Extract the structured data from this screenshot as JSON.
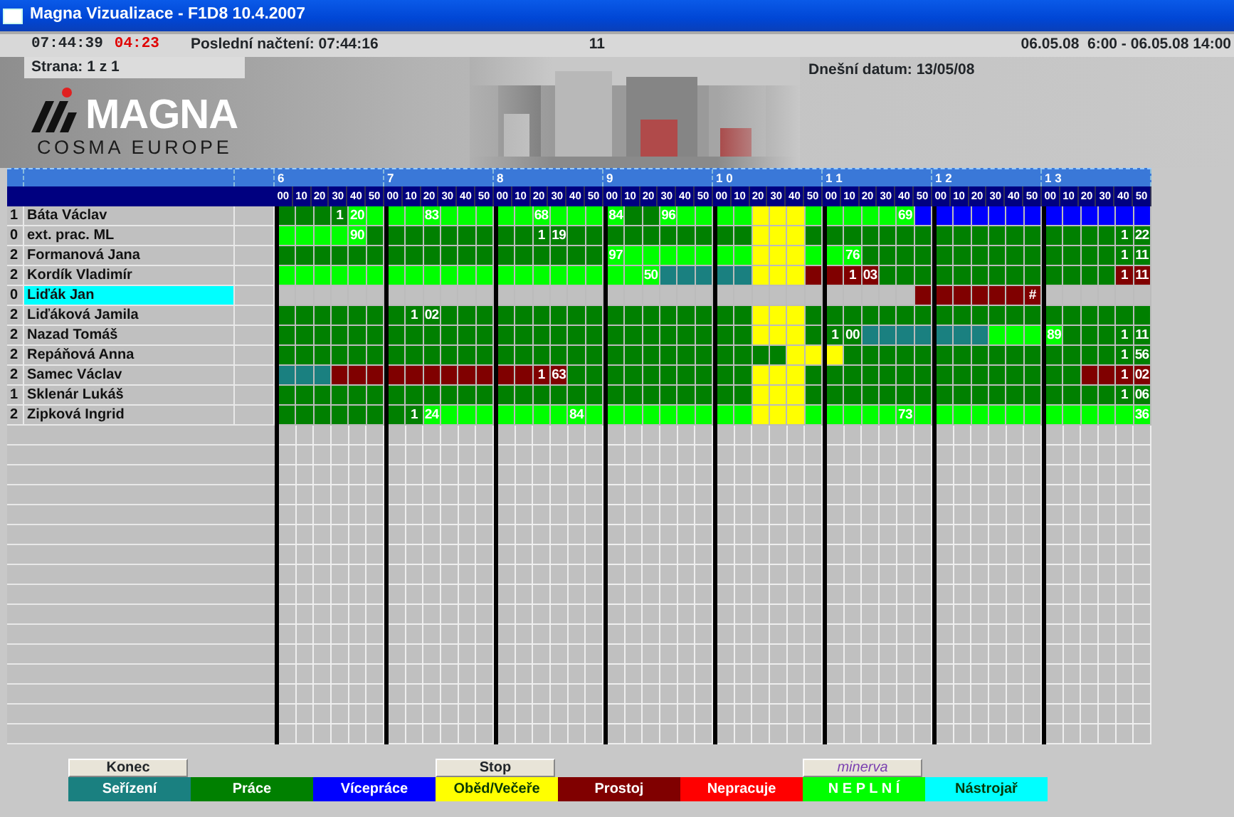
{
  "window": {
    "title": "Magna Vizualizace - F1D8 10.4.2007"
  },
  "info_bar": {
    "clock": "07:44:39",
    "timer": "04:23",
    "last_load": "Poslední načtení: 07:44:16",
    "count": "11",
    "shift": "06.05.08  6:00 - 06.05.08 14:00"
  },
  "page_info": "Strana: 1 z 1",
  "today": "Dnešní datum: 13/05/08",
  "logo": {
    "name": "MAGNA",
    "subtitle": "COSMA EUROPE"
  },
  "hours": [
    {
      "label": "6",
      "minutes": [
        "00",
        "10",
        "20",
        "30",
        "40",
        "50"
      ]
    },
    {
      "label": "7",
      "minutes": [
        "00",
        "10",
        "20",
        "30",
        "40",
        "50"
      ]
    },
    {
      "label": "8",
      "minutes": [
        "00",
        "10",
        "20",
        "30",
        "40",
        "50"
      ]
    },
    {
      "label": "9",
      "minutes": [
        "00",
        "10",
        "20",
        "30",
        "40",
        "50"
      ]
    },
    {
      "label": "1 0",
      "minutes": [
        "00",
        "10",
        "20",
        "30",
        "40",
        "50"
      ]
    },
    {
      "label": "1 1",
      "minutes": [
        "00",
        "10",
        "20",
        "30",
        "40",
        "50"
      ]
    },
    {
      "label": "1 2",
      "minutes": [
        "00",
        "10",
        "20",
        "30",
        "40",
        "50"
      ]
    },
    {
      "label": "1 3",
      "minutes": [
        "00",
        "10",
        "20",
        "30",
        "40",
        "50"
      ]
    }
  ],
  "rows": [
    {
      "number": "1",
      "name": "Báta Václav",
      "highlighted": false,
      "cells": [
        {
          "kind": "work"
        },
        {
          "kind": "work"
        },
        {
          "kind": "work"
        },
        {
          "kind": "work",
          "text": "1"
        },
        {
          "kind": "short",
          "text": "20"
        },
        {
          "kind": "short"
        },
        {
          "kind": "short"
        },
        {
          "kind": "short"
        },
        {
          "kind": "short",
          "text": "83"
        },
        {
          "kind": "short"
        },
        {
          "kind": "short"
        },
        {
          "kind": "short"
        },
        {
          "kind": "short"
        },
        {
          "kind": "short"
        },
        {
          "kind": "short",
          "text": "68"
        },
        {
          "kind": "short"
        },
        {
          "kind": "short"
        },
        {
          "kind": "short"
        },
        {
          "kind": "short",
          "text": "84"
        },
        {
          "kind": "work"
        },
        {
          "kind": "work"
        },
        {
          "kind": "short",
          "text": "96"
        },
        {
          "kind": "short"
        },
        {
          "kind": "short"
        },
        {
          "kind": "short"
        },
        {
          "kind": "short"
        },
        {
          "kind": "lunch"
        },
        {
          "kind": "lunch"
        },
        {
          "kind": "lunch"
        },
        {
          "kind": "short"
        },
        {
          "kind": "short"
        },
        {
          "kind": "short"
        },
        {
          "kind": "short"
        },
        {
          "kind": "short"
        },
        {
          "kind": "short",
          "text": "69"
        },
        {
          "kind": "extra"
        },
        {
          "kind": "extra"
        },
        {
          "kind": "extra"
        },
        {
          "kind": "extra"
        },
        {
          "kind": "extra"
        },
        {
          "kind": "extra"
        },
        {
          "kind": "extra"
        },
        {
          "kind": "extra"
        },
        {
          "kind": "extra"
        },
        {
          "kind": "extra"
        },
        {
          "kind": "extra"
        },
        {
          "kind": "extra"
        },
        {
          "kind": "extra"
        }
      ]
    },
    {
      "number": "0",
      "name": "ext. prac. ML",
      "highlighted": false,
      "cells": [
        {
          "kind": "short"
        },
        {
          "kind": "short"
        },
        {
          "kind": "short"
        },
        {
          "kind": "short"
        },
        {
          "kind": "short",
          "text": "90"
        },
        {
          "kind": "work"
        },
        {
          "kind": "work"
        },
        {
          "kind": "work"
        },
        {
          "kind": "work"
        },
        {
          "kind": "work"
        },
        {
          "kind": "work"
        },
        {
          "kind": "work"
        },
        {
          "kind": "work"
        },
        {
          "kind": "work"
        },
        {
          "kind": "work",
          "text": "1"
        },
        {
          "kind": "work",
          "text": "19"
        },
        {
          "kind": "work"
        },
        {
          "kind": "work"
        },
        {
          "kind": "work"
        },
        {
          "kind": "work"
        },
        {
          "kind": "work"
        },
        {
          "kind": "work"
        },
        {
          "kind": "work"
        },
        {
          "kind": "work"
        },
        {
          "kind": "work"
        },
        {
          "kind": "work"
        },
        {
          "kind": "lunch"
        },
        {
          "kind": "lunch"
        },
        {
          "kind": "lunch"
        },
        {
          "kind": "work"
        },
        {
          "kind": "work"
        },
        {
          "kind": "work"
        },
        {
          "kind": "work"
        },
        {
          "kind": "work"
        },
        {
          "kind": "work"
        },
        {
          "kind": "work"
        },
        {
          "kind": "work"
        },
        {
          "kind": "work"
        },
        {
          "kind": "work"
        },
        {
          "kind": "work"
        },
        {
          "kind": "work"
        },
        {
          "kind": "work"
        },
        {
          "kind": "work"
        },
        {
          "kind": "work"
        },
        {
          "kind": "work"
        },
        {
          "kind": "work"
        },
        {
          "kind": "work",
          "text": "1"
        },
        {
          "kind": "work",
          "text": "22"
        }
      ]
    },
    {
      "number": "2",
      "name": "Formanová Jana",
      "highlighted": false,
      "cells": [
        {
          "kind": "work"
        },
        {
          "kind": "work"
        },
        {
          "kind": "work"
        },
        {
          "kind": "work"
        },
        {
          "kind": "work"
        },
        {
          "kind": "work"
        },
        {
          "kind": "work"
        },
        {
          "kind": "work"
        },
        {
          "kind": "work"
        },
        {
          "kind": "work"
        },
        {
          "kind": "work"
        },
        {
          "kind": "work"
        },
        {
          "kind": "work"
        },
        {
          "kind": "work"
        },
        {
          "kind": "work"
        },
        {
          "kind": "work"
        },
        {
          "kind": "work"
        },
        {
          "kind": "work"
        },
        {
          "kind": "short",
          "text": "97"
        },
        {
          "kind": "short"
        },
        {
          "kind": "short"
        },
        {
          "kind": "short"
        },
        {
          "kind": "short"
        },
        {
          "kind": "short"
        },
        {
          "kind": "short"
        },
        {
          "kind": "short"
        },
        {
          "kind": "lunch"
        },
        {
          "kind": "lunch"
        },
        {
          "kind": "lunch"
        },
        {
          "kind": "short"
        },
        {
          "kind": "short"
        },
        {
          "kind": "short",
          "text": "76"
        },
        {
          "kind": "work"
        },
        {
          "kind": "work"
        },
        {
          "kind": "work"
        },
        {
          "kind": "work"
        },
        {
          "kind": "work"
        },
        {
          "kind": "work"
        },
        {
          "kind": "work"
        },
        {
          "kind": "work"
        },
        {
          "kind": "work"
        },
        {
          "kind": "work"
        },
        {
          "kind": "work"
        },
        {
          "kind": "work"
        },
        {
          "kind": "work"
        },
        {
          "kind": "work"
        },
        {
          "kind": "work",
          "text": "1"
        },
        {
          "kind": "work",
          "text": "11"
        }
      ]
    },
    {
      "number": "2",
      "name": "Kordík Vladimír",
      "highlighted": false,
      "cells": [
        {
          "kind": "short"
        },
        {
          "kind": "short"
        },
        {
          "kind": "short"
        },
        {
          "kind": "short"
        },
        {
          "kind": "short"
        },
        {
          "kind": "short"
        },
        {
          "kind": "short"
        },
        {
          "kind": "short"
        },
        {
          "kind": "short"
        },
        {
          "kind": "short"
        },
        {
          "kind": "short"
        },
        {
          "kind": "short"
        },
        {
          "kind": "short"
        },
        {
          "kind": "short"
        },
        {
          "kind": "short"
        },
        {
          "kind": "short"
        },
        {
          "kind": "short"
        },
        {
          "kind": "short"
        },
        {
          "kind": "short"
        },
        {
          "kind": "short"
        },
        {
          "kind": "short",
          "text": "50"
        },
        {
          "kind": "setup"
        },
        {
          "kind": "setup"
        },
        {
          "kind": "setup"
        },
        {
          "kind": "setup"
        },
        {
          "kind": "setup"
        },
        {
          "kind": "lunch"
        },
        {
          "kind": "lunch"
        },
        {
          "kind": "lunch"
        },
        {
          "kind": "downtime"
        },
        {
          "kind": "downtime"
        },
        {
          "kind": "downtime",
          "text": "1"
        },
        {
          "kind": "downtime",
          "text": "03"
        },
        {
          "kind": "work"
        },
        {
          "kind": "work"
        },
        {
          "kind": "work"
        },
        {
          "kind": "work"
        },
        {
          "kind": "work"
        },
        {
          "kind": "work"
        },
        {
          "kind": "work"
        },
        {
          "kind": "work"
        },
        {
          "kind": "work"
        },
        {
          "kind": "work"
        },
        {
          "kind": "work"
        },
        {
          "kind": "work"
        },
        {
          "kind": "work"
        },
        {
          "kind": "downtime",
          "text": "1"
        },
        {
          "kind": "downtime",
          "text": "11"
        }
      ]
    },
    {
      "number": "0",
      "name": "Liďák Jan",
      "highlighted": true,
      "cells": [
        {
          "kind": "none"
        },
        {
          "kind": "none"
        },
        {
          "kind": "none"
        },
        {
          "kind": "none"
        },
        {
          "kind": "none"
        },
        {
          "kind": "none"
        },
        {
          "kind": "none"
        },
        {
          "kind": "none"
        },
        {
          "kind": "none"
        },
        {
          "kind": "none"
        },
        {
          "kind": "none"
        },
        {
          "kind": "none"
        },
        {
          "kind": "none"
        },
        {
          "kind": "none"
        },
        {
          "kind": "none"
        },
        {
          "kind": "none"
        },
        {
          "kind": "none"
        },
        {
          "kind": "none"
        },
        {
          "kind": "none"
        },
        {
          "kind": "none"
        },
        {
          "kind": "none"
        },
        {
          "kind": "none"
        },
        {
          "kind": "none"
        },
        {
          "kind": "none"
        },
        {
          "kind": "none"
        },
        {
          "kind": "none"
        },
        {
          "kind": "none"
        },
        {
          "kind": "none"
        },
        {
          "kind": "none"
        },
        {
          "kind": "none"
        },
        {
          "kind": "none"
        },
        {
          "kind": "none"
        },
        {
          "kind": "none"
        },
        {
          "kind": "none"
        },
        {
          "kind": "none"
        },
        {
          "kind": "downtime"
        },
        {
          "kind": "downtime"
        },
        {
          "kind": "downtime"
        },
        {
          "kind": "downtime"
        },
        {
          "kind": "downtime"
        },
        {
          "kind": "downtime"
        },
        {
          "kind": "downtime",
          "text": "#"
        },
        {
          "kind": "none"
        },
        {
          "kind": "none"
        },
        {
          "kind": "none"
        },
        {
          "kind": "none"
        },
        {
          "kind": "none"
        },
        {
          "kind": "none"
        }
      ]
    },
    {
      "number": "2",
      "name": "Liďáková Jamila",
      "highlighted": false,
      "cells": [
        {
          "kind": "work"
        },
        {
          "kind": "work"
        },
        {
          "kind": "work"
        },
        {
          "kind": "work"
        },
        {
          "kind": "work"
        },
        {
          "kind": "work"
        },
        {
          "kind": "work"
        },
        {
          "kind": "work",
          "text": "1"
        },
        {
          "kind": "work",
          "text": "02"
        },
        {
          "kind": "work"
        },
        {
          "kind": "work"
        },
        {
          "kind": "work"
        },
        {
          "kind": "work"
        },
        {
          "kind": "work"
        },
        {
          "kind": "work"
        },
        {
          "kind": "work"
        },
        {
          "kind": "work"
        },
        {
          "kind": "work"
        },
        {
          "kind": "work"
        },
        {
          "kind": "work"
        },
        {
          "kind": "work"
        },
        {
          "kind": "work"
        },
        {
          "kind": "work"
        },
        {
          "kind": "work"
        },
        {
          "kind": "work"
        },
        {
          "kind": "work"
        },
        {
          "kind": "lunch"
        },
        {
          "kind": "lunch"
        },
        {
          "kind": "lunch"
        },
        {
          "kind": "work"
        },
        {
          "kind": "work"
        },
        {
          "kind": "work"
        },
        {
          "kind": "work"
        },
        {
          "kind": "work"
        },
        {
          "kind": "work"
        },
        {
          "kind": "work"
        },
        {
          "kind": "work"
        },
        {
          "kind": "work"
        },
        {
          "kind": "work"
        },
        {
          "kind": "work"
        },
        {
          "kind": "work"
        },
        {
          "kind": "work"
        },
        {
          "kind": "work"
        },
        {
          "kind": "work"
        },
        {
          "kind": "work"
        },
        {
          "kind": "work"
        },
        {
          "kind": "work"
        },
        {
          "kind": "work"
        }
      ]
    },
    {
      "number": "2",
      "name": "Nazad Tomáš",
      "highlighted": false,
      "cells": [
        {
          "kind": "work"
        },
        {
          "kind": "work"
        },
        {
          "kind": "work"
        },
        {
          "kind": "work"
        },
        {
          "kind": "work"
        },
        {
          "kind": "work"
        },
        {
          "kind": "work"
        },
        {
          "kind": "work"
        },
        {
          "kind": "work"
        },
        {
          "kind": "work"
        },
        {
          "kind": "work"
        },
        {
          "kind": "work"
        },
        {
          "kind": "work"
        },
        {
          "kind": "work"
        },
        {
          "kind": "work"
        },
        {
          "kind": "work"
        },
        {
          "kind": "work"
        },
        {
          "kind": "work"
        },
        {
          "kind": "work"
        },
        {
          "kind": "work"
        },
        {
          "kind": "work"
        },
        {
          "kind": "work"
        },
        {
          "kind": "work"
        },
        {
          "kind": "work"
        },
        {
          "kind": "work"
        },
        {
          "kind": "work"
        },
        {
          "kind": "lunch"
        },
        {
          "kind": "lunch"
        },
        {
          "kind": "lunch"
        },
        {
          "kind": "work"
        },
        {
          "kind": "work",
          "text": "1"
        },
        {
          "kind": "work",
          "text": "00"
        },
        {
          "kind": "setup"
        },
        {
          "kind": "setup"
        },
        {
          "kind": "setup"
        },
        {
          "kind": "setup"
        },
        {
          "kind": "setup"
        },
        {
          "kind": "setup"
        },
        {
          "kind": "setup"
        },
        {
          "kind": "short"
        },
        {
          "kind": "short"
        },
        {
          "kind": "short"
        },
        {
          "kind": "short",
          "text": "89"
        },
        {
          "kind": "work"
        },
        {
          "kind": "work"
        },
        {
          "kind": "work"
        },
        {
          "kind": "work",
          "text": "1"
        },
        {
          "kind": "work",
          "text": "11"
        }
      ]
    },
    {
      "number": "2",
      "name": "Repáňová Anna",
      "highlighted": false,
      "cells": [
        {
          "kind": "work"
        },
        {
          "kind": "work"
        },
        {
          "kind": "work"
        },
        {
          "kind": "work"
        },
        {
          "kind": "work"
        },
        {
          "kind": "work"
        },
        {
          "kind": "work"
        },
        {
          "kind": "work"
        },
        {
          "kind": "work"
        },
        {
          "kind": "work"
        },
        {
          "kind": "work"
        },
        {
          "kind": "work"
        },
        {
          "kind": "work"
        },
        {
          "kind": "work"
        },
        {
          "kind": "work"
        },
        {
          "kind": "work"
        },
        {
          "kind": "work"
        },
        {
          "kind": "work"
        },
        {
          "kind": "work"
        },
        {
          "kind": "work"
        },
        {
          "kind": "work"
        },
        {
          "kind": "work"
        },
        {
          "kind": "work"
        },
        {
          "kind": "work"
        },
        {
          "kind": "work"
        },
        {
          "kind": "work"
        },
        {
          "kind": "work"
        },
        {
          "kind": "work"
        },
        {
          "kind": "lunch"
        },
        {
          "kind": "lunch"
        },
        {
          "kind": "lunch"
        },
        {
          "kind": "work"
        },
        {
          "kind": "work"
        },
        {
          "kind": "work"
        },
        {
          "kind": "work"
        },
        {
          "kind": "work"
        },
        {
          "kind": "work"
        },
        {
          "kind": "work"
        },
        {
          "kind": "work"
        },
        {
          "kind": "work"
        },
        {
          "kind": "work"
        },
        {
          "kind": "work"
        },
        {
          "kind": "work"
        },
        {
          "kind": "work"
        },
        {
          "kind": "work"
        },
        {
          "kind": "work"
        },
        {
          "kind": "work",
          "text": "1"
        },
        {
          "kind": "work",
          "text": "56"
        }
      ]
    },
    {
      "number": "2",
      "name": "Samec Václav",
      "highlighted": false,
      "cells": [
        {
          "kind": "setup"
        },
        {
          "kind": "setup"
        },
        {
          "kind": "setup"
        },
        {
          "kind": "downtime"
        },
        {
          "kind": "downtime"
        },
        {
          "kind": "downtime"
        },
        {
          "kind": "downtime"
        },
        {
          "kind": "downtime"
        },
        {
          "kind": "downtime"
        },
        {
          "kind": "downtime"
        },
        {
          "kind": "downtime"
        },
        {
          "kind": "downtime"
        },
        {
          "kind": "downtime"
        },
        {
          "kind": "downtime"
        },
        {
          "kind": "downtime",
          "text": "1"
        },
        {
          "kind": "downtime",
          "text": "63"
        },
        {
          "kind": "work"
        },
        {
          "kind": "work"
        },
        {
          "kind": "work"
        },
        {
          "kind": "work"
        },
        {
          "kind": "work"
        },
        {
          "kind": "work"
        },
        {
          "kind": "work"
        },
        {
          "kind": "work"
        },
        {
          "kind": "work"
        },
        {
          "kind": "work"
        },
        {
          "kind": "lunch"
        },
        {
          "kind": "lunch"
        },
        {
          "kind": "lunch"
        },
        {
          "kind": "work"
        },
        {
          "kind": "work"
        },
        {
          "kind": "work"
        },
        {
          "kind": "work"
        },
        {
          "kind": "work"
        },
        {
          "kind": "work"
        },
        {
          "kind": "work"
        },
        {
          "kind": "work"
        },
        {
          "kind": "work"
        },
        {
          "kind": "work"
        },
        {
          "kind": "work"
        },
        {
          "kind": "work"
        },
        {
          "kind": "work"
        },
        {
          "kind": "work"
        },
        {
          "kind": "work"
        },
        {
          "kind": "downtime"
        },
        {
          "kind": "downtime"
        },
        {
          "kind": "downtime",
          "text": "1"
        },
        {
          "kind": "downtime",
          "text": "02"
        }
      ]
    },
    {
      "number": "1",
      "name": "Sklenár Lukáš",
      "highlighted": false,
      "cells": [
        {
          "kind": "work"
        },
        {
          "kind": "work"
        },
        {
          "kind": "work"
        },
        {
          "kind": "work"
        },
        {
          "kind": "work"
        },
        {
          "kind": "work"
        },
        {
          "kind": "work"
        },
        {
          "kind": "work"
        },
        {
          "kind": "work"
        },
        {
          "kind": "work"
        },
        {
          "kind": "work"
        },
        {
          "kind": "work"
        },
        {
          "kind": "work"
        },
        {
          "kind": "work"
        },
        {
          "kind": "work"
        },
        {
          "kind": "work"
        },
        {
          "kind": "work"
        },
        {
          "kind": "work"
        },
        {
          "kind": "work"
        },
        {
          "kind": "work"
        },
        {
          "kind": "work"
        },
        {
          "kind": "work"
        },
        {
          "kind": "work"
        },
        {
          "kind": "work"
        },
        {
          "kind": "work"
        },
        {
          "kind": "work"
        },
        {
          "kind": "lunch"
        },
        {
          "kind": "lunch"
        },
        {
          "kind": "lunch"
        },
        {
          "kind": "work"
        },
        {
          "kind": "work"
        },
        {
          "kind": "work"
        },
        {
          "kind": "work"
        },
        {
          "kind": "work"
        },
        {
          "kind": "work"
        },
        {
          "kind": "work"
        },
        {
          "kind": "work"
        },
        {
          "kind": "work"
        },
        {
          "kind": "work"
        },
        {
          "kind": "work"
        },
        {
          "kind": "work"
        },
        {
          "kind": "work"
        },
        {
          "kind": "work"
        },
        {
          "kind": "work"
        },
        {
          "kind": "work"
        },
        {
          "kind": "work"
        },
        {
          "kind": "work",
          "text": "1"
        },
        {
          "kind": "work",
          "text": "06"
        }
      ]
    },
    {
      "number": "2",
      "name": "Zipková Ingrid",
      "highlighted": false,
      "cells": [
        {
          "kind": "work"
        },
        {
          "kind": "work"
        },
        {
          "kind": "work"
        },
        {
          "kind": "work"
        },
        {
          "kind": "work"
        },
        {
          "kind": "work"
        },
        {
          "kind": "work"
        },
        {
          "kind": "work",
          "text": "1"
        },
        {
          "kind": "short",
          "text": "24"
        },
        {
          "kind": "short"
        },
        {
          "kind": "short"
        },
        {
          "kind": "short"
        },
        {
          "kind": "short"
        },
        {
          "kind": "short"
        },
        {
          "kind": "short"
        },
        {
          "kind": "short"
        },
        {
          "kind": "short",
          "text": "84"
        },
        {
          "kind": "short"
        },
        {
          "kind": "short"
        },
        {
          "kind": "short"
        },
        {
          "kind": "short"
        },
        {
          "kind": "short"
        },
        {
          "kind": "short"
        },
        {
          "kind": "short"
        },
        {
          "kind": "short"
        },
        {
          "kind": "short"
        },
        {
          "kind": "lunch"
        },
        {
          "kind": "lunch"
        },
        {
          "kind": "lunch"
        },
        {
          "kind": "short"
        },
        {
          "kind": "short"
        },
        {
          "kind": "short"
        },
        {
          "kind": "short"
        },
        {
          "kind": "short"
        },
        {
          "kind": "short",
          "text": "73"
        },
        {
          "kind": "short"
        },
        {
          "kind": "short"
        },
        {
          "kind": "short"
        },
        {
          "kind": "short"
        },
        {
          "kind": "short"
        },
        {
          "kind": "short"
        },
        {
          "kind": "short"
        },
        {
          "kind": "short"
        },
        {
          "kind": "short"
        },
        {
          "kind": "short"
        },
        {
          "kind": "short"
        },
        {
          "kind": "short"
        },
        {
          "kind": "short",
          "text": "36"
        }
      ]
    }
  ],
  "buttons": [
    {
      "label": "Konec",
      "kind": "plain"
    },
    {
      "label": "Stop",
      "kind": "plain"
    },
    {
      "label": "minerva",
      "kind": "brand"
    }
  ],
  "legend": [
    {
      "label": "Seřízení",
      "kind": "setup",
      "color": "#1a8080"
    },
    {
      "label": "Práce",
      "kind": "work",
      "color": "#008000"
    },
    {
      "label": "Vícepráce",
      "kind": "extra",
      "color": "#0000ff"
    },
    {
      "label": "Oběd/Večeře",
      "kind": "lunch",
      "color": "#ffff00"
    },
    {
      "label": "Prostoj",
      "kind": "downtime",
      "color": "#800000"
    },
    {
      "label": "Nepracuje",
      "kind": "idle",
      "color": "#ff0000"
    },
    {
      "label": "N E P L N Í",
      "kind": "short",
      "color": "#00ff00"
    },
    {
      "label": "Nástrojař",
      "kind": "tool",
      "color": "#00ffff"
    }
  ]
}
